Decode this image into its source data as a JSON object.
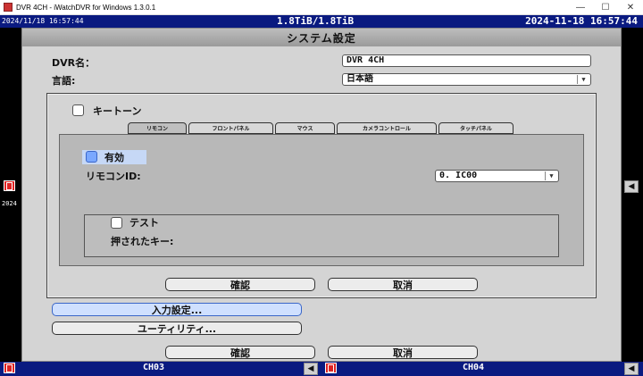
{
  "window": {
    "title": "DVR 4CH - iWatchDVR for Windows 1.3.0.1",
    "min": "—",
    "max": "☐",
    "close": "✕"
  },
  "status": {
    "osd_time_small": "2024/11/18 16:57:44",
    "storage": "1.8TiB/1.8TiB",
    "datetime": "2024-11-18 16:57:44"
  },
  "cameras": {
    "osd_left": "2024",
    "ch3": "CH03",
    "ch4": "CH04"
  },
  "system": {
    "title": "システム設定",
    "dvr_name_label": "DVR名：",
    "dvr_name_value": "DVR 4CH",
    "language_label": "言語:",
    "language_value": "日本語",
    "input_settings": "入力設定...",
    "utility": "ユーティリティ...",
    "ok": "確認",
    "cancel": "取消"
  },
  "keytone": {
    "title": "キートーン",
    "tabs": [
      "リモコン",
      "フロントパネル",
      "マウス",
      "カメラコントロール",
      "タッチパネル"
    ],
    "enable_label": "有効",
    "remote_id_label": "リモコンID:",
    "remote_id_value": "0. IC00",
    "test_label": "テスト",
    "pressed_key_label": "押されたキー:",
    "ok": "確認",
    "cancel": "取消"
  }
}
